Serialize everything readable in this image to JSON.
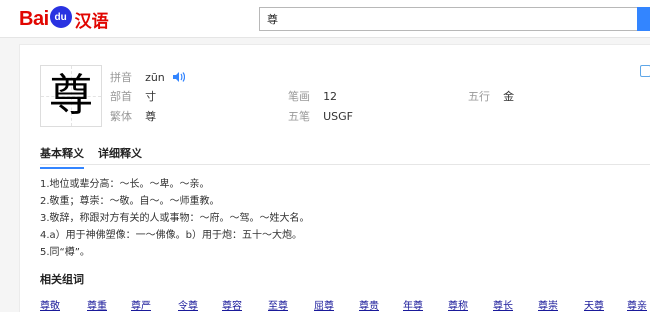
{
  "logo": {
    "bai": "Bai",
    "du": "du",
    "hanyu": "汉语"
  },
  "search": {
    "value": "尊"
  },
  "character": "尊",
  "pinyin": {
    "label": "拼音",
    "value": "zūn"
  },
  "bushou": {
    "label": "部首",
    "value": "寸"
  },
  "bihua": {
    "label": "笔画",
    "value": "12"
  },
  "wuxing": {
    "label": "五行",
    "value": "金"
  },
  "fanti": {
    "label": "繁体",
    "value": "尊"
  },
  "wubi": {
    "label": "五笔",
    "value": "USGF"
  },
  "tabs": [
    "基本释义",
    "详细释义"
  ],
  "definitions": [
    "1.地位或辈分高：～长。～卑。～亲。",
    "2.敬重；尊崇：～敬。自～。～师重教。",
    "3.敬辞，称跟对方有关的人或事物：～府。～驾。～姓大名。",
    "4.a）用于神佛塑像：一～佛像。b）用于炮：五十～大炮。",
    "5.同“樽”。"
  ],
  "related_title": "相关组词",
  "related_words": [
    "尊敬",
    "尊重",
    "尊严",
    "令尊",
    "尊容",
    "至尊",
    "屈尊",
    "尊贵",
    "年尊",
    "尊称",
    "尊长",
    "尊崇",
    "天尊",
    "尊亲"
  ],
  "colors": {
    "brand_red": "#e10601",
    "brand_blue": "#2932e1",
    "accent": "#3385ff",
    "link": "#1a1a9a"
  }
}
